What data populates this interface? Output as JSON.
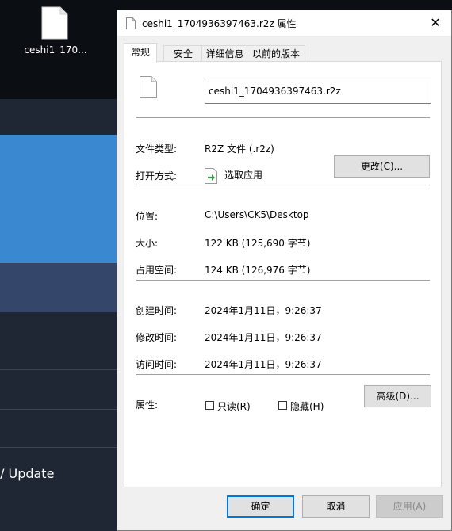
{
  "desktop": {
    "icon_label": "ceshi1_170...",
    "background_text": "/ Update"
  },
  "dialog": {
    "title": "ceshi1_1704936397463.r2z 属性",
    "close_glyph": "✕",
    "tabs": [
      "常规",
      "安全",
      "详细信息",
      "以前的版本"
    ],
    "filename": "ceshi1_1704936397463.r2z",
    "file_type": {
      "label": "文件类型:",
      "value": "R2Z 文件 (.r2z)"
    },
    "opens_with": {
      "label": "打开方式:",
      "value": "选取应用",
      "button": "更改(C)..."
    },
    "location": {
      "label": "位置:",
      "value": "C:\\Users\\CK5\\Desktop"
    },
    "size": {
      "label": "大小:",
      "value": "122 KB (125,690 字节)"
    },
    "size_on_disk": {
      "label": "占用空间:",
      "value": "124 KB (126,976 字节)"
    },
    "created": {
      "label": "创建时间:",
      "value": "2024年1月11日，9:26:37"
    },
    "modified": {
      "label": "修改时间:",
      "value": "2024年1月11日，9:26:37"
    },
    "accessed": {
      "label": "访问时间:",
      "value": "2024年1月11日，9:26:37"
    },
    "attributes": {
      "label": "属性:",
      "readonly": {
        "label": "只读(R)",
        "checked": false
      },
      "hidden": {
        "label": "隐藏(H)",
        "checked": false
      },
      "advanced_button": "高级(D)..."
    },
    "footer": {
      "ok": "确定",
      "cancel": "取消",
      "apply": "应用(A)"
    }
  },
  "colors": {
    "accent": "#0078d7",
    "background_blue": "#3a88cf",
    "background_navy": "#35466b"
  }
}
